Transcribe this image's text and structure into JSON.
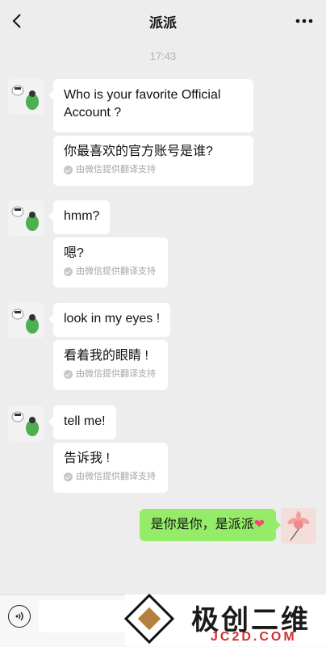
{
  "header": {
    "title": "派派",
    "back_icon": "chevron-left-icon",
    "more_icon": "ellipsis-icon"
  },
  "timestamp": "17:43",
  "translation_note": "由微信提供翻译支持",
  "messages": [
    {
      "text": "Who is your favorite Official Account ?",
      "translation": "你最喜欢的官方账号是谁?"
    },
    {
      "text": "hmm?",
      "translation": "嗯?"
    },
    {
      "text": "look in my eyes !",
      "translation": "看着我的眼睛 !"
    },
    {
      "text": "tell me!",
      "translation": "告诉我 !"
    }
  ],
  "my_message": {
    "text": "是你是你，是派派",
    "emoji": "❤"
  },
  "watermark": {
    "brand": "极创二维",
    "site": "JC2D.COM"
  },
  "colors": {
    "my_bubble": "#95ec69",
    "background": "#ededed"
  }
}
